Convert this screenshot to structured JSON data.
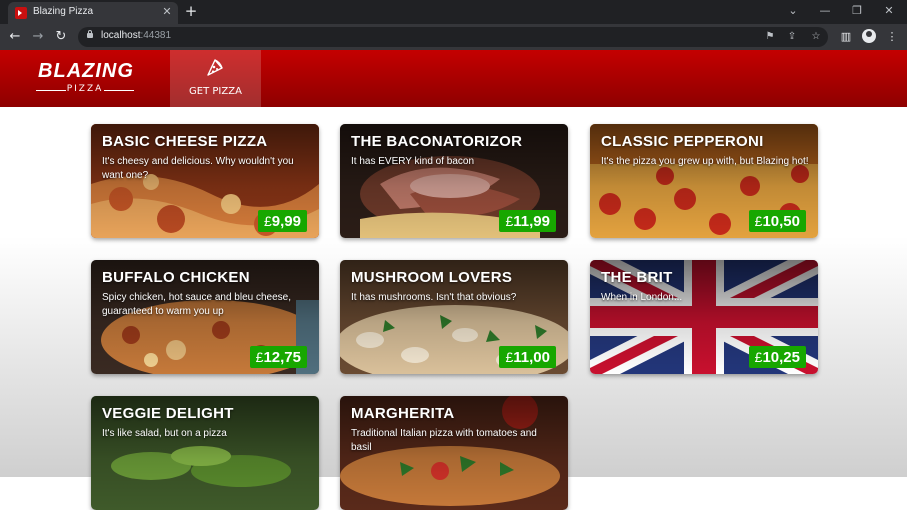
{
  "browser": {
    "tab_title": "Blazing Pizza",
    "tab_close": "✕",
    "new_tab": "+",
    "url_host": "localhost",
    "url_port": ":44381"
  },
  "header": {
    "logo_text": "BLAZING",
    "logo_sub": "PIZZA",
    "nav_label": "GET PIZZA"
  },
  "colors": {
    "header_red": "#c40000",
    "price_green": "#17a700"
  },
  "specials": [
    {
      "name": "BASIC CHEESE PIZZA",
      "description": "It's cheesy and delicious. Why wouldn't you want one?",
      "price": "9,99",
      "currency": "£",
      "image": "cheese-pizza"
    },
    {
      "name": "THE BACONATORIZOR",
      "description": "It has EVERY kind of bacon",
      "price": "11,99",
      "currency": "£",
      "image": "bacon-pizza"
    },
    {
      "name": "CLASSIC PEPPERONI",
      "description": "It's the pizza you grew up with, but Blazing hot!",
      "price": "10,50",
      "currency": "£",
      "image": "pepperoni-pizza"
    },
    {
      "name": "BUFFALO CHICKEN",
      "description": "Spicy chicken, hot sauce and bleu cheese, guaranteed to warm you up",
      "price": "12,75",
      "currency": "£",
      "image": "chicken-pizza"
    },
    {
      "name": "MUSHROOM LOVERS",
      "description": "It has mushrooms. Isn't that obvious?",
      "price": "11,00",
      "currency": "£",
      "image": "mushroom-pizza"
    },
    {
      "name": "THE BRIT",
      "description": "When in London...",
      "price": "10,25",
      "currency": "£",
      "image": "union-jack"
    },
    {
      "name": "VEGGIE DELIGHT",
      "description": "It's like salad, but on a pizza",
      "price": "",
      "currency": "",
      "image": "veggie-pizza"
    },
    {
      "name": "MARGHERITA",
      "description": "Traditional Italian pizza with tomatoes and basil",
      "price": "",
      "currency": "",
      "image": "margherita-pizza"
    }
  ]
}
